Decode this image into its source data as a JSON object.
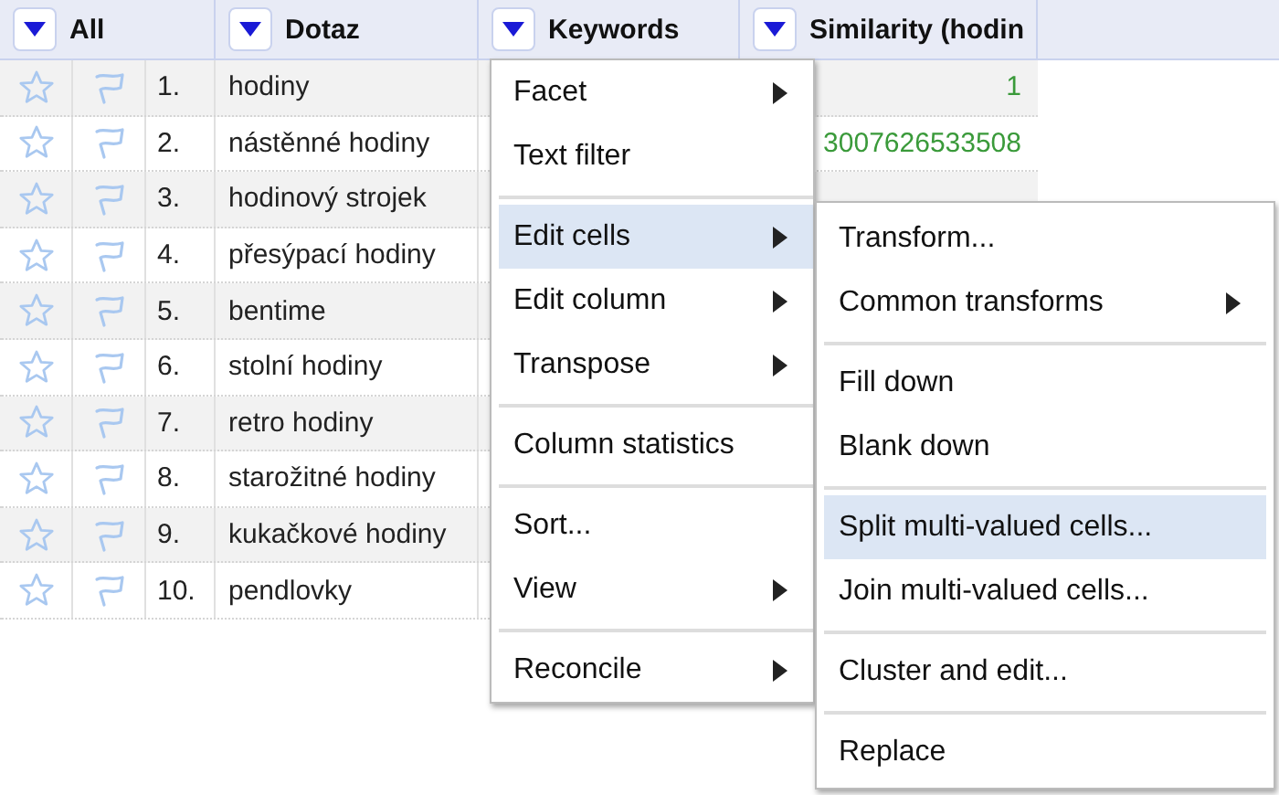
{
  "columns": [
    {
      "label": "All"
    },
    {
      "label": "Dotaz"
    },
    {
      "label": "Keywords"
    },
    {
      "label": "Similarity (hodin"
    }
  ],
  "rows": [
    {
      "starred": false,
      "flagged": false,
      "number": "1.",
      "dotaz": "hodiny",
      "similarity": "1"
    },
    {
      "starred": false,
      "flagged": false,
      "number": "2.",
      "dotaz": "nástěnné hodiny",
      "similarity": "3007626533508"
    },
    {
      "starred": false,
      "flagged": false,
      "number": "3.",
      "dotaz": "hodinový strojek"
    },
    {
      "starred": false,
      "flagged": false,
      "number": "4.",
      "dotaz": "přesýpací hodiny"
    },
    {
      "starred": false,
      "flagged": false,
      "number": "5.",
      "dotaz": "bentime"
    },
    {
      "starred": false,
      "flagged": false,
      "number": "6.",
      "dotaz": "stolní hodiny"
    },
    {
      "starred": false,
      "flagged": false,
      "number": "7.",
      "dotaz": "retro hodiny"
    },
    {
      "starred": false,
      "flagged": false,
      "number": "8.",
      "dotaz": "starožitné hodiny"
    },
    {
      "starred": false,
      "flagged": false,
      "number": "9.",
      "dotaz": "kukačkové hodiny"
    },
    {
      "starred": false,
      "flagged": false,
      "number": "10.",
      "dotaz": "pendlovky"
    }
  ],
  "column_menu": [
    {
      "kind": "item",
      "label": "Facet",
      "has_submenu": true,
      "selected": false
    },
    {
      "kind": "item",
      "label": "Text filter",
      "has_submenu": false,
      "selected": false
    },
    {
      "kind": "separator"
    },
    {
      "kind": "item",
      "label": "Edit cells",
      "has_submenu": true,
      "selected": true
    },
    {
      "kind": "item",
      "label": "Edit column",
      "has_submenu": true,
      "selected": false
    },
    {
      "kind": "item",
      "label": "Transpose",
      "has_submenu": true,
      "selected": false
    },
    {
      "kind": "separator"
    },
    {
      "kind": "item",
      "label": "Column statistics",
      "has_submenu": false,
      "selected": false
    },
    {
      "kind": "separator"
    },
    {
      "kind": "item",
      "label": "Sort...",
      "has_submenu": false,
      "selected": false
    },
    {
      "kind": "item",
      "label": "View",
      "has_submenu": true,
      "selected": false
    },
    {
      "kind": "separator"
    },
    {
      "kind": "item",
      "label": "Reconcile",
      "has_submenu": true,
      "selected": false
    }
  ],
  "edit_cells_submenu": [
    {
      "kind": "item",
      "label": "Transform...",
      "has_submenu": false,
      "selected": false
    },
    {
      "kind": "item",
      "label": "Common transforms",
      "has_submenu": true,
      "selected": false
    },
    {
      "kind": "separator"
    },
    {
      "kind": "item",
      "label": "Fill down",
      "has_submenu": false,
      "selected": false
    },
    {
      "kind": "item",
      "label": "Blank down",
      "has_submenu": false,
      "selected": false
    },
    {
      "kind": "separator"
    },
    {
      "kind": "item",
      "label": "Split multi-valued cells...",
      "has_submenu": false,
      "selected": true
    },
    {
      "kind": "item",
      "label": "Join multi-valued cells...",
      "has_submenu": false,
      "selected": false
    },
    {
      "kind": "separator"
    },
    {
      "kind": "item",
      "label": "Cluster and edit...",
      "has_submenu": false,
      "selected": false
    },
    {
      "kind": "separator"
    },
    {
      "kind": "item",
      "label": "Replace",
      "has_submenu": false,
      "selected": false
    }
  ]
}
